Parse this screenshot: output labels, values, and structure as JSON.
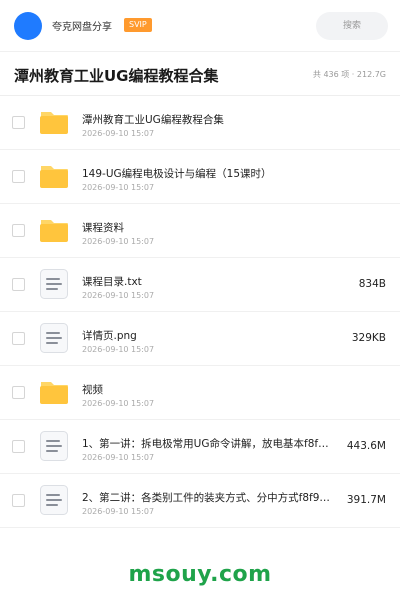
{
  "header": {
    "brand": "夸克网盘分享",
    "badge": "SVIP",
    "search_placeholder": "搜索"
  },
  "title_bar": {
    "title": "潭州教育工业UG编程教程合集",
    "meta": "共 436 项 · 212.7G"
  },
  "files": [
    {
      "type": "folder",
      "icon": "folder-icon",
      "name": "潭州教育工业UG编程教程合集",
      "date": "2026-09-10 15:07",
      "size": ""
    },
    {
      "type": "folder",
      "icon": "folder-icon",
      "name": "149-UG编程电极设计与编程（15课时）",
      "date": "2026-09-10 15:07",
      "size": ""
    },
    {
      "type": "folder",
      "icon": "folder-icon",
      "name": "课程资料",
      "date": "2026-09-10 15:07",
      "size": ""
    },
    {
      "type": "file",
      "icon": "document-icon",
      "name": "课程目录.txt",
      "date": "2026-09-10 15:07",
      "size": "834B"
    },
    {
      "type": "file",
      "icon": "document-icon",
      "name": "详情页.png",
      "date": "2026-09-10 15:07",
      "size": "329KB"
    },
    {
      "type": "folder",
      "icon": "folder-icon",
      "name": "视频",
      "date": "2026-09-10 15:07",
      "size": ""
    },
    {
      "type": "file",
      "icon": "document-icon",
      "name": "1、第一讲：拆电极常用UG命令讲解，放电基本f8f…",
      "date": "2026-09-10 15:07",
      "size": "443.6M"
    },
    {
      "type": "file",
      "icon": "document-icon",
      "name": "2、第二讲：各类别工件的装夹方式、分中方式f8f9…",
      "date": "2026-09-10 15:07",
      "size": "391.7M"
    }
  ],
  "watermark": "msouy.com",
  "colors": {
    "accent": "#1f7bff",
    "badge": "#ff9a2e",
    "folder": "#ffc53d",
    "watermark": "#1fa34a"
  }
}
